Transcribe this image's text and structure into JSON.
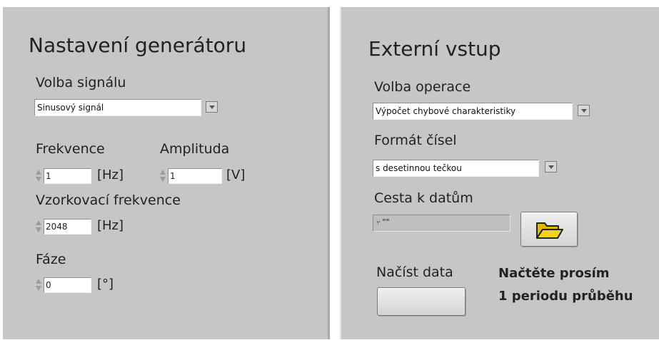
{
  "generator": {
    "title": "Nastavení generátoru",
    "signal_label": "Volba signálu",
    "signal_value": "Sinusový signál",
    "frequency_label": "Frekvence",
    "frequency_value": "1",
    "frequency_unit": "[Hz]",
    "amplitude_label": "Amplituda",
    "amplitude_value": "1",
    "amplitude_unit": "[V]",
    "sampling_label": "Vzorkovací frekvence",
    "sampling_value": "2048",
    "sampling_unit": "[Hz]",
    "phase_label": "Fáze",
    "phase_value": "0",
    "phase_unit": "[°]"
  },
  "external": {
    "title": "Externí vstup",
    "operation_label": "Volba operace",
    "operation_value": "Výpočet chybové charakteristiky",
    "format_label": "Formát čísel",
    "format_value": "s desetinnou tečkou",
    "path_label": "Cesta k datům",
    "path_value": "\"\"",
    "load_label": "Načíst data",
    "message_line1": "Načtěte prosím",
    "message_line2": "1 periodu průběhu"
  },
  "icons": {
    "browse": "folder-open-icon",
    "dropdown": "dropdown-arrow-icon",
    "spinner": "spin-arrows-icon",
    "path": "path-icon"
  },
  "colors": {
    "panel_bg": "#c6c6c6",
    "folder_yellow": "#f2d21a"
  }
}
